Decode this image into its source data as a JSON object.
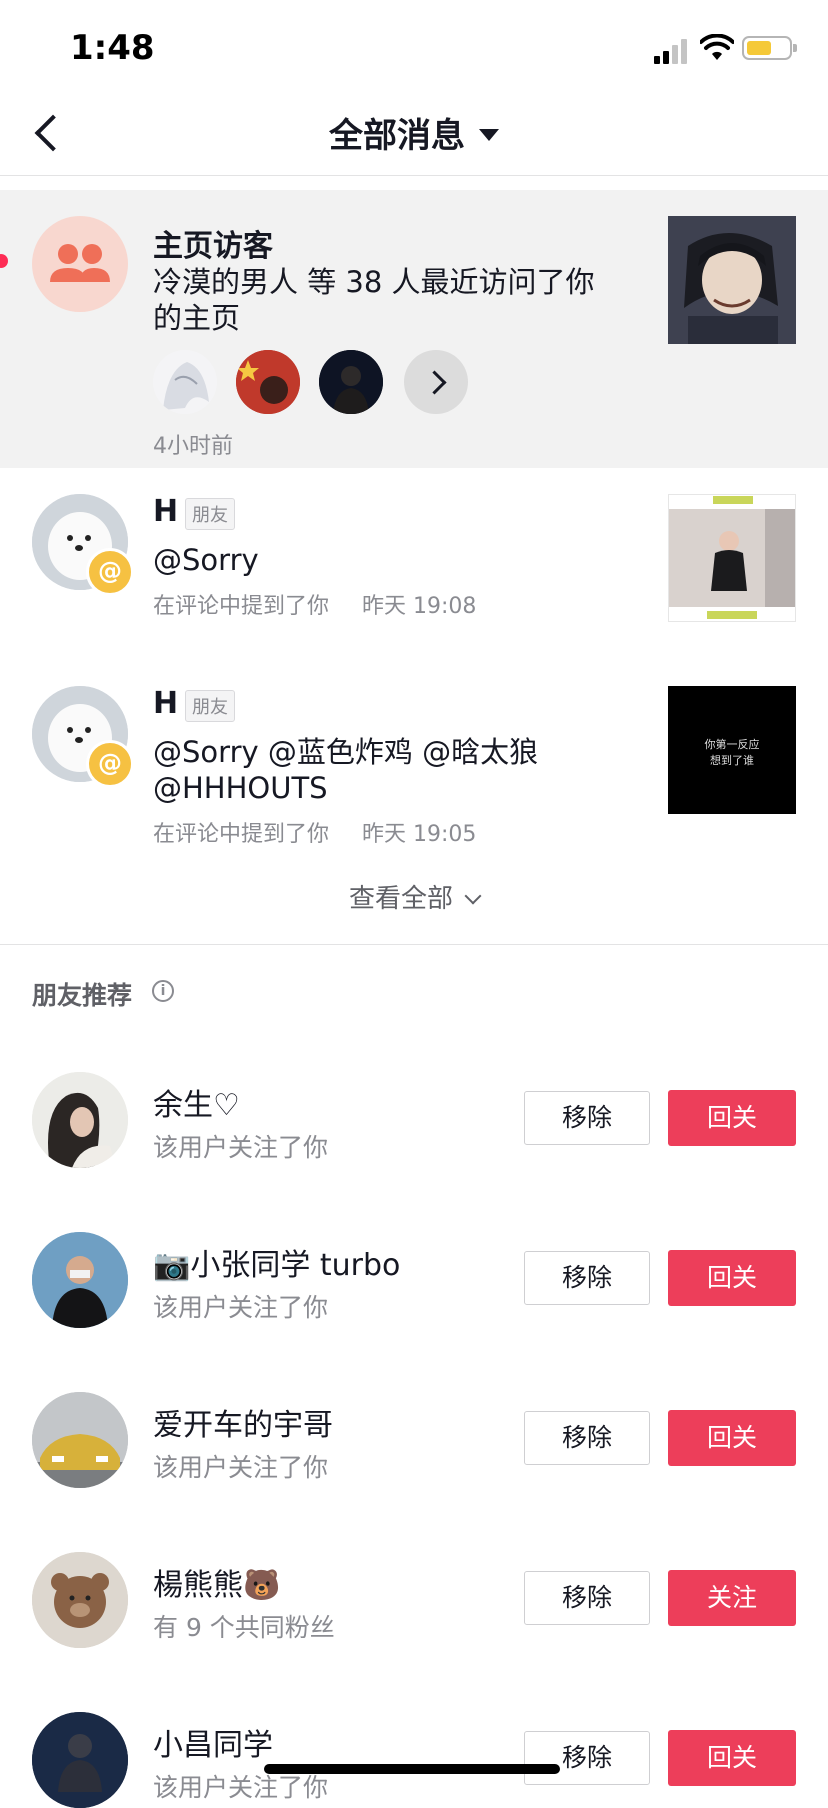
{
  "status_bar": {
    "time": "1:48"
  },
  "nav": {
    "title": "全部消息"
  },
  "visitor": {
    "title": "主页访客",
    "line1": "冷漠的男人 等 38 人最近访问了你",
    "line2": "的主页",
    "time": "4小时前"
  },
  "mentions": [
    {
      "name": "H",
      "tag": "朋友",
      "text_line1": "@Sorry",
      "text_line2": "",
      "action": "在评论中提到了你",
      "time": "昨天 19:08"
    },
    {
      "name": "H",
      "tag": "朋友",
      "text_line1": "@Sorry @蓝色炸鸡 @晗太狼",
      "text_line2": "@HHHOUTS",
      "action": "在评论中提到了你",
      "time": "昨天 19:05",
      "thumb_text_1": "你第一反应",
      "thumb_text_2": "想到了谁"
    }
  ],
  "view_all": "查看全部",
  "recommend": {
    "section_title": "朋友推荐",
    "items": [
      {
        "name": "余生♡",
        "sub": "该用户关注了你",
        "remove": "移除",
        "action": "回关"
      },
      {
        "name": "📷小张同学 turbo",
        "sub": "该用户关注了你",
        "remove": "移除",
        "action": "回关"
      },
      {
        "name": "爱开车的宇哥",
        "sub": "该用户关注了你",
        "remove": "移除",
        "action": "回关"
      },
      {
        "name": "楊熊熊🐻",
        "sub": "有 9 个共同粉丝",
        "remove": "移除",
        "action": "关注"
      },
      {
        "name": "小昌同学",
        "sub": "该用户关注了你",
        "remove": "移除",
        "action": "回关"
      }
    ]
  },
  "colors": {
    "accent": "#ed3e5a",
    "visitor_bg": "#f2f2f2",
    "badge": "#f6c142",
    "unread_dot": "#fe2c55"
  },
  "icons": [
    "back-icon",
    "dropdown-caret-icon",
    "group-icon",
    "chevron-right-icon",
    "at-icon",
    "chevron-down-icon",
    "info-icon"
  ]
}
